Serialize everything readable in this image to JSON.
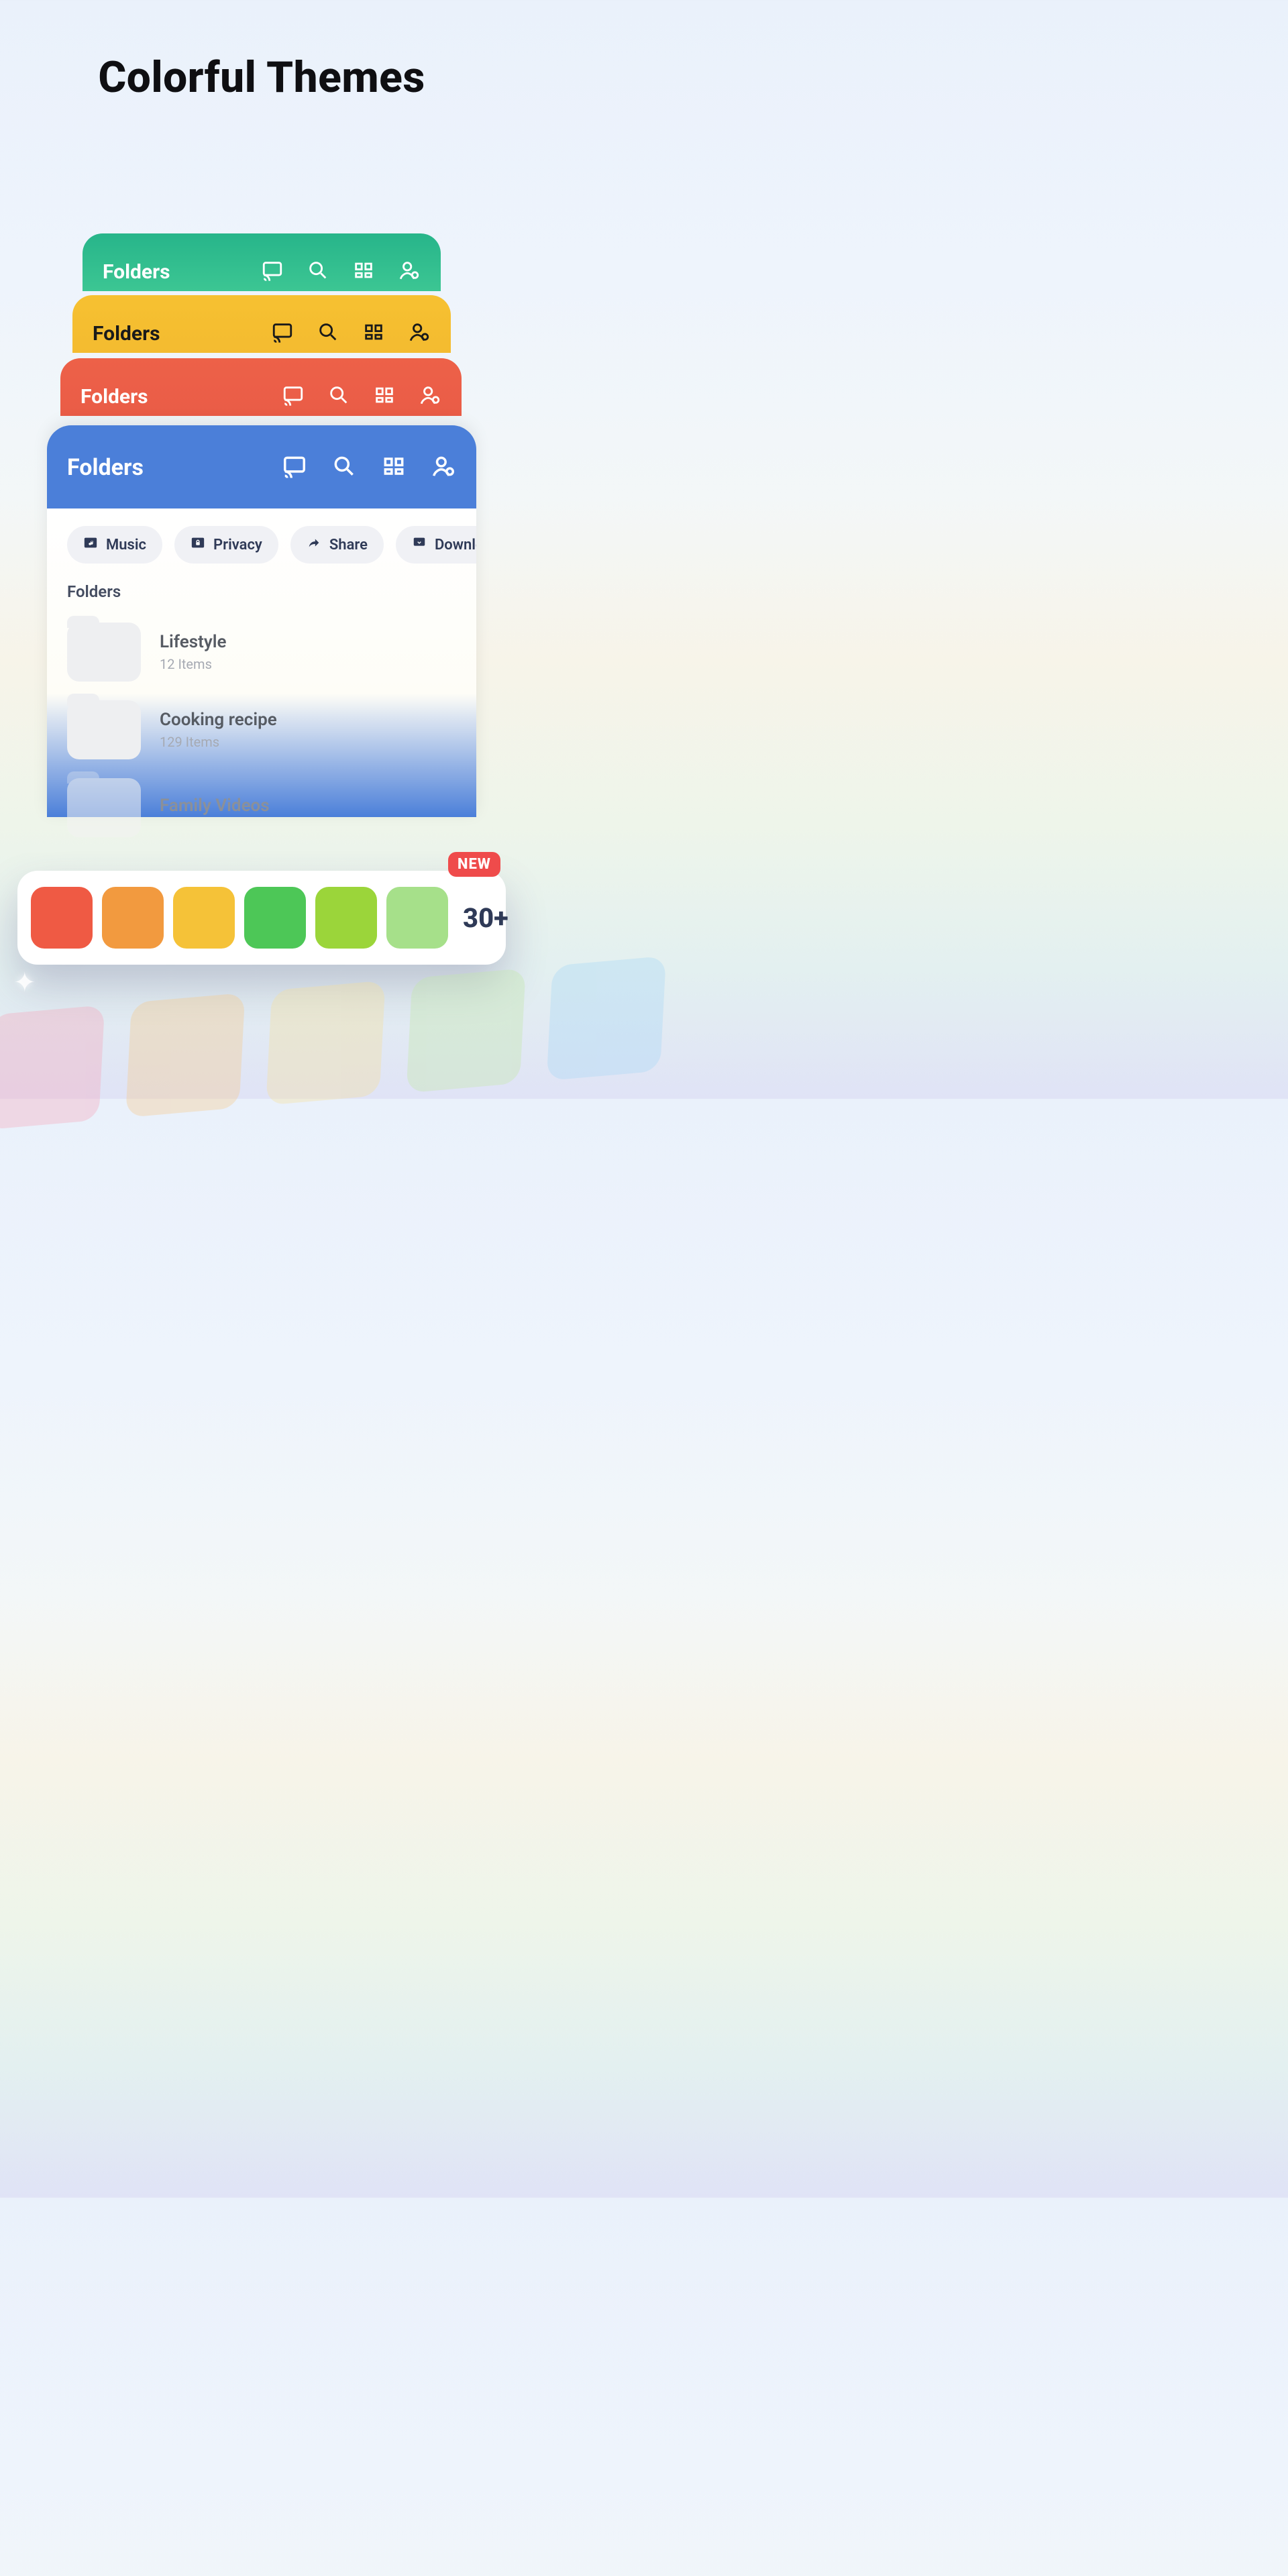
{
  "title": "Colorful Themes",
  "header_label": "Folders",
  "theme_cards": {
    "green": {
      "color": "#27b58a"
    },
    "yellow": {
      "color": "#f6c131"
    },
    "red": {
      "color": "#ed6148"
    },
    "blue": {
      "color": "#4b7fd9"
    }
  },
  "icons": {
    "cast": "cast-icon",
    "search": "search-icon",
    "grid": "grid-view-icon",
    "user": "user-account-icon"
  },
  "chips": [
    {
      "icon": "music-folder-icon",
      "label": "Music"
    },
    {
      "icon": "lock-folder-icon",
      "label": "Privacy"
    },
    {
      "icon": "share-icon",
      "label": "Share"
    },
    {
      "icon": "download-icon",
      "label": "Downloade"
    }
  ],
  "section_label": "Folders",
  "folders": [
    {
      "name": "Lifestyle",
      "count": "12 Items"
    },
    {
      "name": "Cooking recipe",
      "count": "129 Items"
    },
    {
      "name": "Family Videos",
      "count": ""
    }
  ],
  "palette": {
    "new_label": "NEW",
    "more_label": "30+",
    "swatches": [
      "#ef5a44",
      "#f29a3f",
      "#f5c238",
      "#4dc757",
      "#9bd53a",
      "#a6e08a"
    ]
  },
  "ghost_colors": [
    "#f6a6bb",
    "#f6c98a",
    "#f6df9a",
    "#c2e8a8",
    "#a7d8f6"
  ]
}
